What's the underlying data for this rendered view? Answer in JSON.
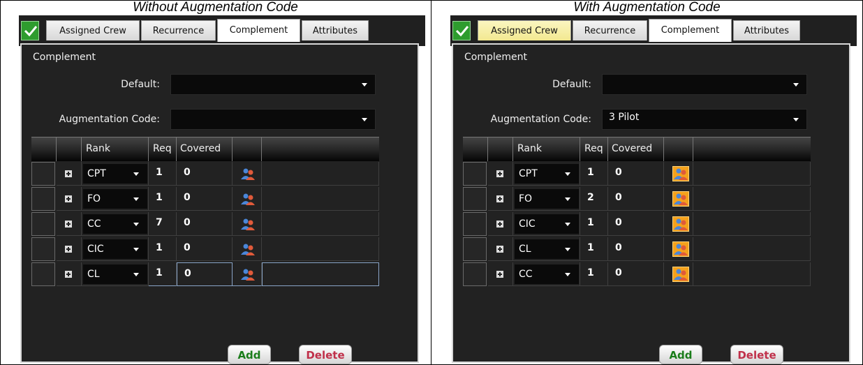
{
  "panels": [
    {
      "caption": "Without Augmentation Code",
      "tabs": [
        "Assigned Crew",
        "Recurrence",
        "Complement",
        "Attributes"
      ],
      "active_tab": "Complement",
      "section_title": "Complement",
      "default_label": "Default:",
      "default_value": "",
      "augmentation_label": "Augmentation Code:",
      "augmentation_value": "",
      "grid": {
        "headers": {
          "rank": "Rank",
          "req": "Req",
          "covered": "Covered"
        },
        "rows": [
          {
            "rank": "CPT",
            "req": "1",
            "covered": "0"
          },
          {
            "rank": "FO",
            "req": "1",
            "covered": "0"
          },
          {
            "rank": "CC",
            "req": "7",
            "covered": "0"
          },
          {
            "rank": "CIC",
            "req": "1",
            "covered": "0"
          },
          {
            "rank": "CL",
            "req": "1",
            "covered": "0"
          }
        ]
      },
      "add_label": "Add",
      "delete_label": "Delete"
    },
    {
      "caption": "With Augmentation Code",
      "tabs": [
        "Assigned Crew",
        "Recurrence",
        "Complement",
        "Attributes"
      ],
      "active_tab": "Complement",
      "section_title": "Complement",
      "default_label": "Default:",
      "default_value": "",
      "augmentation_label": "Augmentation Code:",
      "augmentation_value": "3 Pilot",
      "grid": {
        "headers": {
          "rank": "Rank",
          "req": "Req",
          "covered": "Covered"
        },
        "rows": [
          {
            "rank": "CPT",
            "req": "1",
            "covered": "0"
          },
          {
            "rank": "FO",
            "req": "2",
            "covered": "0"
          },
          {
            "rank": "CIC",
            "req": "1",
            "covered": "0"
          },
          {
            "rank": "CL",
            "req": "1",
            "covered": "0"
          },
          {
            "rank": "CC",
            "req": "1",
            "covered": "0"
          }
        ]
      },
      "add_label": "Add",
      "delete_label": "Delete"
    }
  ],
  "icons": {
    "status": "check-icon",
    "expand": "plus-expand-icon",
    "crew": "crew-people-icon",
    "dropdown": "chevron-down-icon"
  },
  "colors": {
    "status_green": "#2e9c2e",
    "highlight_tab": "#f2e890",
    "add_text": "#1b7d1b",
    "delete_text": "#c0304a",
    "crew_icon_box": "#f4a11c"
  }
}
